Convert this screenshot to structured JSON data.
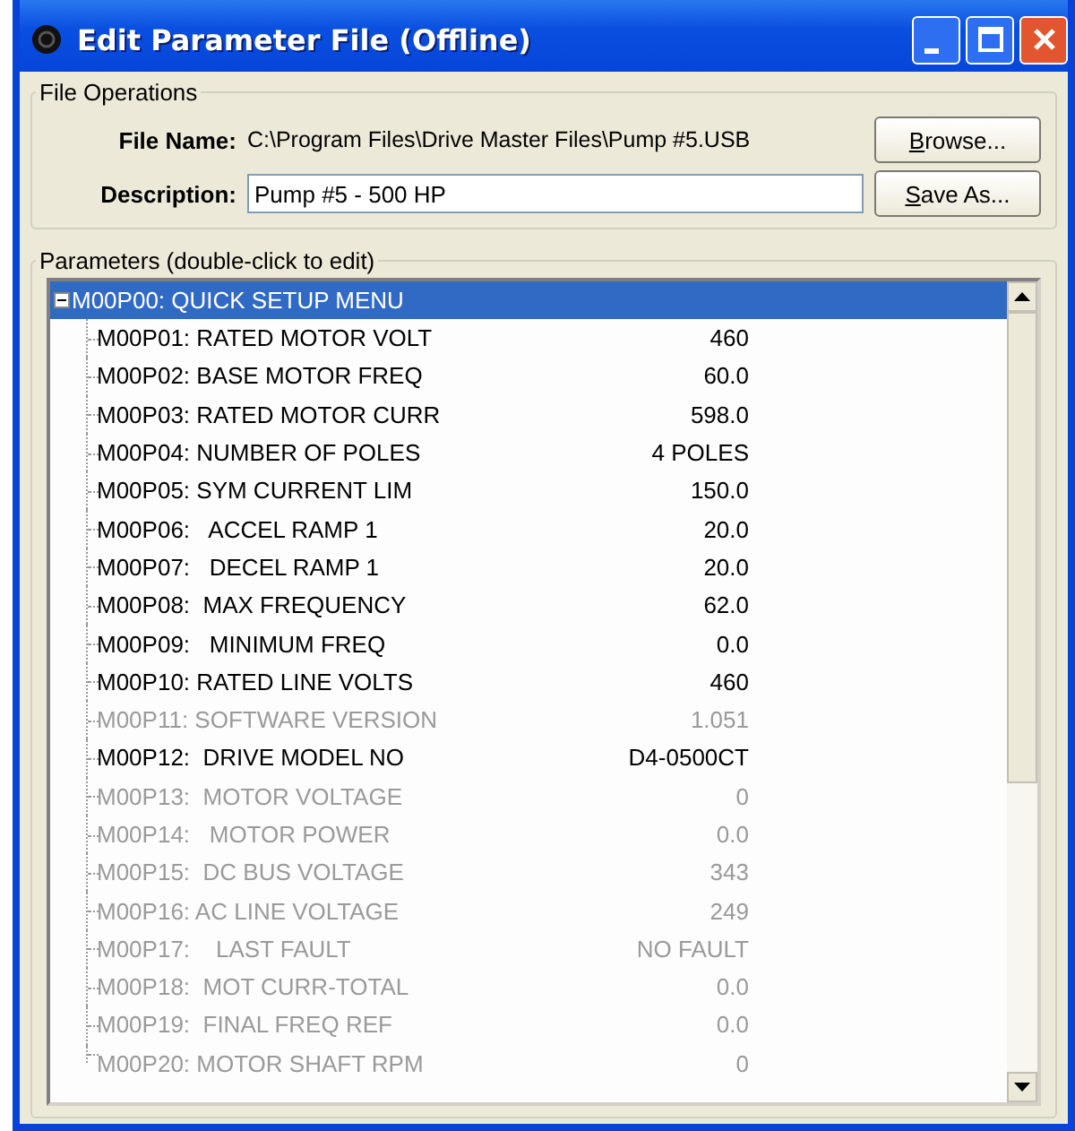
{
  "window": {
    "title": "Edit Parameter File (Offline)"
  },
  "file_operations": {
    "title": "File Operations",
    "file_name_label": "File Name:",
    "file_name": "C:\\Program Files\\Drive Master Files\\Pump #5.USB",
    "description_label": "Description:",
    "description": "Pump #5 - 500 HP",
    "buttons": [
      "Browse...",
      "Save As..."
    ]
  },
  "parameters": {
    "title": "Parameters (double-click to edit)",
    "tree": {
      "label": "M00P00: QUICK SETUP MENU",
      "selected": true,
      "expanded": true,
      "children": [
        {
          "label": "M00P01: RATED MOTOR VOLT",
          "value": "460",
          "disabled": false
        },
        {
          "label": "M00P02: BASE MOTOR FREQ",
          "value": "60.0",
          "disabled": false
        },
        {
          "label": "M00P03: RATED MOTOR CURR",
          "value": "598.0",
          "disabled": false
        },
        {
          "label": "M00P04: NUMBER OF POLES",
          "value": "4 POLES",
          "disabled": false
        },
        {
          "label": "M00P05: SYM CURRENT LIM",
          "value": "150.0",
          "disabled": false
        },
        {
          "label": "M00P06:   ACCEL RAMP 1",
          "value": "20.0",
          "disabled": false
        },
        {
          "label": "M00P07:   DECEL RAMP 1",
          "value": "20.0",
          "disabled": false
        },
        {
          "label": "M00P08:  MAX FREQUENCY",
          "value": "62.0",
          "disabled": false
        },
        {
          "label": "M00P09:   MINIMUM FREQ",
          "value": "0.0",
          "disabled": false
        },
        {
          "label": "M00P10: RATED LINE VOLTS",
          "value": "460",
          "disabled": false
        },
        {
          "label": "M00P11: SOFTWARE VERSION",
          "value": "1.051",
          "disabled": true
        },
        {
          "label": "M00P12:  DRIVE MODEL NO",
          "value": "D4-0500CT",
          "disabled": false
        },
        {
          "label": "M00P13:  MOTOR VOLTAGE",
          "value": "0",
          "disabled": true
        },
        {
          "label": "M00P14:   MOTOR POWER",
          "value": "0.0",
          "disabled": true
        },
        {
          "label": "M00P15:  DC BUS VOLTAGE",
          "value": "343",
          "disabled": true
        },
        {
          "label": "M00P16: AC LINE VOLTAGE",
          "value": "249",
          "disabled": true
        },
        {
          "label": "M00P17:    LAST FAULT",
          "value": "NO FAULT",
          "disabled": true
        },
        {
          "label": "M00P18:  MOT CURR-TOTAL",
          "value": "0.0",
          "disabled": true
        },
        {
          "label": "M00P19:  FINAL FREQ REF",
          "value": "0.0",
          "disabled": true
        },
        {
          "label": "M00P20: MOTOR SHAFT RPM",
          "value": "0",
          "disabled": true
        }
      ]
    }
  }
}
